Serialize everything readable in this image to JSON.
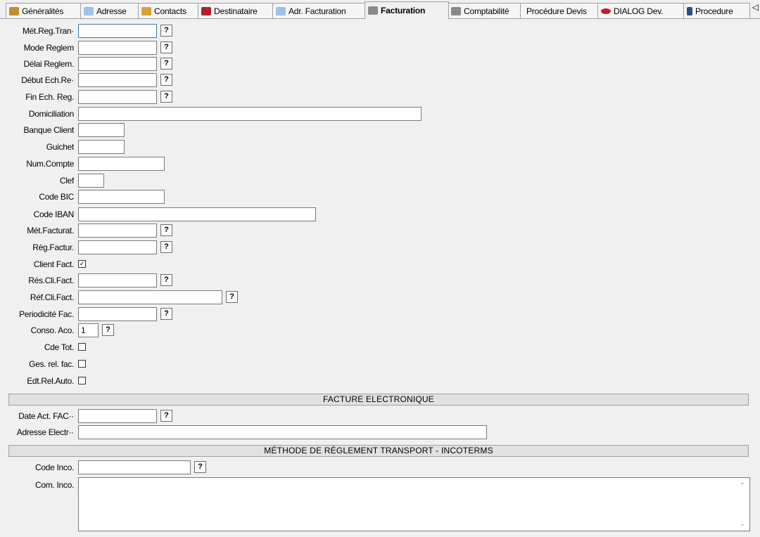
{
  "tabs": [
    {
      "label": "Généralités",
      "icon": "document-icon",
      "color": "#c98b2f",
      "active": false
    },
    {
      "label": "Adresse",
      "icon": "envelope-icon",
      "color": "#7fb2dc",
      "active": false
    },
    {
      "label": "Contacts",
      "icon": "people-icon",
      "color": "#d6a23a",
      "active": false
    },
    {
      "label": "Destinataire",
      "icon": "book-icon",
      "color": "#b0202a",
      "active": false
    },
    {
      "label": "Adr. Facturation",
      "icon": "envelope-icon",
      "color": "#7fb2dc",
      "active": false
    },
    {
      "label": "Facturation",
      "icon": "calculator-icon",
      "color": "#8a8a8a",
      "active": true
    },
    {
      "label": "Comptabilité",
      "icon": "calculator-icon",
      "color": "#8a8a8a",
      "active": false
    },
    {
      "label": "Procédure Devis",
      "icon": "",
      "color": "",
      "active": false
    },
    {
      "label": "DIALOG Dev.",
      "icon": "lips-icon",
      "color": "#c0202a",
      "active": false
    },
    {
      "label": "Procedure",
      "icon": "phone-icon",
      "color": "#2a4f8a",
      "active": false
    }
  ],
  "tab_scroll": "◁",
  "help_glyph": "?",
  "check_glyph": "✓",
  "fields": {
    "met_reg_tran": {
      "label": "Mét.Reg.Tran·",
      "value": ""
    },
    "mode_reglement": {
      "label": "Mode Reglem",
      "value": ""
    },
    "delai_reglem": {
      "label": "Délai Reglem.",
      "value": ""
    },
    "debut_ech": {
      "label": "Début Ech.Re·",
      "value": ""
    },
    "fin_ech": {
      "label": "Fin Ech. Reg.",
      "value": ""
    },
    "domiciliation": {
      "label": "Domiciliation",
      "value": ""
    },
    "banque_client": {
      "label": "Banque Client",
      "value": ""
    },
    "guichet": {
      "label": "Guichet",
      "value": ""
    },
    "num_compte": {
      "label": "Num.Compte",
      "value": ""
    },
    "clef": {
      "label": "Clef",
      "value": ""
    },
    "code_bic": {
      "label": "Code BIC",
      "value": ""
    },
    "code_iban": {
      "label": "Code IBAN",
      "value": ""
    },
    "met_facturat": {
      "label": "Mét.Facturat.",
      "value": ""
    },
    "reg_factur": {
      "label": "Règ.Factur.",
      "value": ""
    },
    "client_fact": {
      "label": "Client Fact.",
      "checked": true
    },
    "res_cli_fact": {
      "label": "Rés.Cli.Fact.",
      "value": ""
    },
    "ref_cli_fact": {
      "label": "Réf.Cli.Fact.",
      "value": ""
    },
    "periodicite_fac": {
      "label": "Periodicité Fac.",
      "value": ""
    },
    "conso_aco": {
      "label": "Conso. Aco.",
      "value": "1"
    },
    "cde_tot": {
      "label": "Cde Tot.",
      "checked": false
    },
    "ges_rel_fac": {
      "label": "Ges. rel. fac.",
      "checked": false
    },
    "edt_rel_auto": {
      "label": "Edt.Rel.Auto.",
      "checked": false
    },
    "date_act_fac": {
      "label": "Date Act. FAC··",
      "value": ""
    },
    "adresse_electr": {
      "label": "Adresse Electr··",
      "value": ""
    },
    "code_inco": {
      "label": "Code Inco.",
      "value": ""
    },
    "com_inco": {
      "label": "Com. Inco.",
      "value": ""
    }
  },
  "sections": {
    "facture_electronique": "FACTURE ELECTRONIQUE",
    "methode_reglement": "MÉTHODE DE RÉGLEMENT TRANSPORT - INCOTERMS"
  }
}
